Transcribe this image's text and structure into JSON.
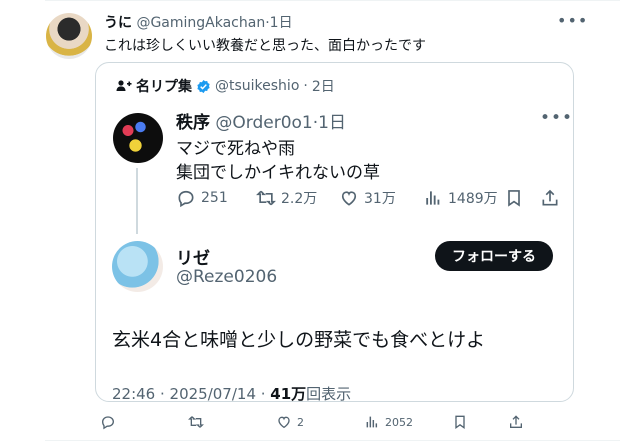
{
  "outer_tweet": {
    "display_name": "うに",
    "handle": "@GamingAkachan",
    "time": "1日",
    "text": "これは珍しくいい教養だと思った、面白かったです",
    "actions": {
      "replies": "",
      "reposts": "",
      "likes": "2",
      "views": "2052"
    }
  },
  "quote": {
    "account_name": "名リプ集",
    "handle": "@tsuikeshio",
    "time": "2日",
    "tweet1": {
      "display_name": "秩序",
      "handle": "@Order0o1",
      "time": "1日",
      "lines": [
        "マジで死ねや雨",
        "集団でしかイキれないの草"
      ],
      "replies": "251",
      "reposts": "2.2万",
      "likes": "31万",
      "views": "1489万"
    },
    "tweet2": {
      "display_name": "リゼ",
      "handle": "@Reze0206",
      "follow_label": "フォローする",
      "text": "玄米4合と味噌と少しの野菜でも食べとけよ",
      "timestamp": "22:46 · 2025/07/14 · ",
      "views_count": "41万",
      "views_suffix": "回表示"
    }
  },
  "colors": {
    "text": "#0f1419",
    "muted": "#536471",
    "border": "#cfd9de",
    "verified": "#1d9bf0"
  }
}
